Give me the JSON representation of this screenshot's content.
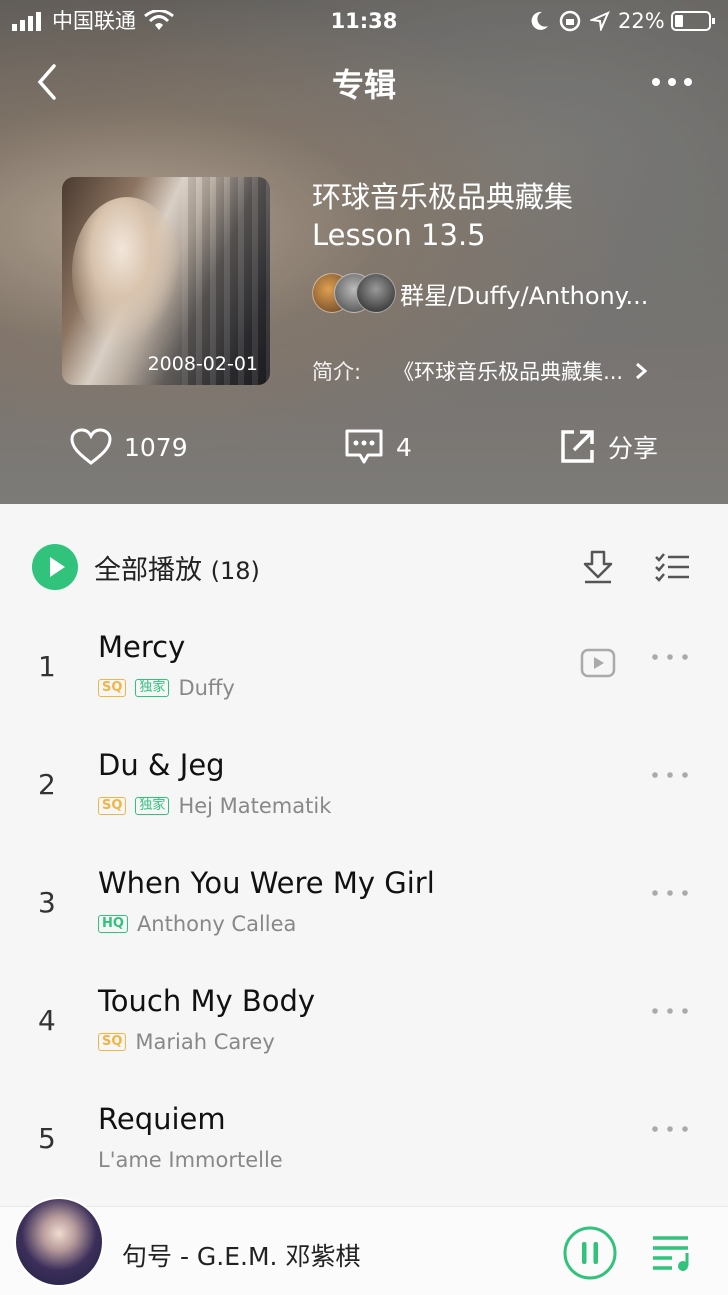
{
  "status_bar": {
    "carrier": "中国联通",
    "time": "11:38",
    "battery": "22%"
  },
  "nav": {
    "title": "专辑"
  },
  "album": {
    "cover_date": "2008-02-01",
    "title_line1": "环球音乐极品典藏集",
    "title_line2": "Lesson 13.5",
    "artists": "群星/Duffy/Anthony...",
    "intro_label": "简介:",
    "intro_text": "《环球音乐极品典藏集..."
  },
  "actions": {
    "likes": "1079",
    "comments": "4",
    "share": "分享"
  },
  "play_all": {
    "label": "全部播放",
    "count": "(18)"
  },
  "tracks": [
    {
      "num": "1",
      "title": "Mercy",
      "quality": "SQ",
      "exclusive": "独家",
      "artist": "Duffy",
      "has_mv": true
    },
    {
      "num": "2",
      "title": "Du & Jeg",
      "quality": "SQ",
      "exclusive": "独家",
      "artist": "Hej Matematik",
      "has_mv": false
    },
    {
      "num": "3",
      "title": "When You Were My Girl",
      "quality": "HQ",
      "exclusive": "",
      "artist": "Anthony Callea",
      "has_mv": false
    },
    {
      "num": "4",
      "title": "Touch My Body",
      "quality": "SQ",
      "exclusive": "",
      "artist": "Mariah Carey",
      "has_mv": false
    },
    {
      "num": "5",
      "title": "Requiem",
      "quality": "",
      "exclusive": "",
      "artist": "L'ame Immortelle",
      "has_mv": false
    }
  ],
  "player": {
    "now_playing": "句号 - G.E.M. 邓紫棋"
  },
  "colors": {
    "accent": "#31c27c",
    "sq": "#f0b544"
  },
  "icons": [
    "back-icon",
    "more-icon",
    "heart-icon",
    "comment-icon",
    "share-icon",
    "play-icon",
    "download-icon",
    "multi-select-icon",
    "mv-icon",
    "pause-icon",
    "playlist-icon",
    "wifi-icon",
    "signal-icon",
    "moon-icon",
    "lock-rotation-icon",
    "location-icon",
    "battery-icon"
  ]
}
